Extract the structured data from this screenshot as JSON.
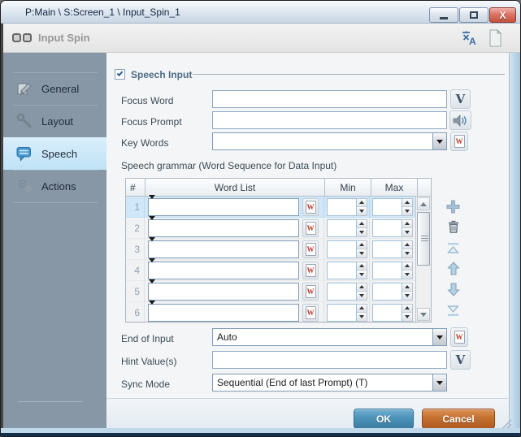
{
  "window": {
    "title": "P:Main \\ S:Screen_1 \\ Input_Spin_1"
  },
  "header": {
    "title": "Input Spin"
  },
  "sidebar": {
    "items": [
      {
        "label": "General",
        "selected": false
      },
      {
        "label": "Layout",
        "selected": false
      },
      {
        "label": "Speech",
        "selected": true
      },
      {
        "label": "Actions",
        "selected": false
      }
    ]
  },
  "speech_section": {
    "label": "Speech Input",
    "checked": true
  },
  "fields": {
    "focus_word": {
      "label": "Focus Word",
      "value": ""
    },
    "focus_prompt": {
      "label": "Focus Prompt",
      "value": ""
    },
    "key_words": {
      "label": "Key Words",
      "value": ""
    },
    "grammar_caption": "Speech grammar (Word Sequence for Data Input)",
    "end_of_input": {
      "label": "End of Input",
      "value": "Auto"
    },
    "hint_values": {
      "label": "Hint Value(s)",
      "value": ""
    },
    "sync_mode": {
      "label": "Sync Mode",
      "value": "Sequential (End of last Prompt) (T)"
    }
  },
  "grammar_table": {
    "columns": [
      "#",
      "Word List",
      "Min",
      "Max"
    ],
    "rows": [
      {
        "num": "1",
        "word_list": "",
        "min": "",
        "max": "",
        "selected": true
      },
      {
        "num": "2",
        "word_list": "",
        "min": "",
        "max": "",
        "selected": false
      },
      {
        "num": "3",
        "word_list": "",
        "min": "",
        "max": "",
        "selected": false
      },
      {
        "num": "4",
        "word_list": "",
        "min": "",
        "max": "",
        "selected": false
      },
      {
        "num": "5",
        "word_list": "",
        "min": "",
        "max": "",
        "selected": false
      },
      {
        "num": "6",
        "word_list": "",
        "min": "",
        "max": "",
        "selected": false
      }
    ]
  },
  "buttons": {
    "ok": "OK",
    "cancel": "Cancel",
    "variable": "V"
  },
  "icons": {
    "close": "X",
    "word_letter": "W",
    "names": [
      "minimize-icon",
      "maximize-icon",
      "close-icon",
      "translate-icon",
      "blank-document-icon",
      "input-spin-icon",
      "edit-icon",
      "wrench-icon",
      "speech-bubble-icon",
      "gears-icon",
      "check-icon",
      "chevron-down-icon",
      "speaker-icon",
      "word-doc-icon",
      "plus-icon",
      "trash-icon",
      "move-top-icon",
      "arrow-up-icon",
      "arrow-down-icon",
      "move-bottom-icon",
      "resize-grip-icon"
    ]
  },
  "colors": {
    "ok_button": "#4d93ba",
    "cancel_button": "#c4702f",
    "close_button": "#dd7365",
    "sidebar": "#8897a6",
    "selected_tab": "#bfe2f6",
    "selected_row": "#cfe7f8",
    "titlebar": "#dbe5ef"
  }
}
